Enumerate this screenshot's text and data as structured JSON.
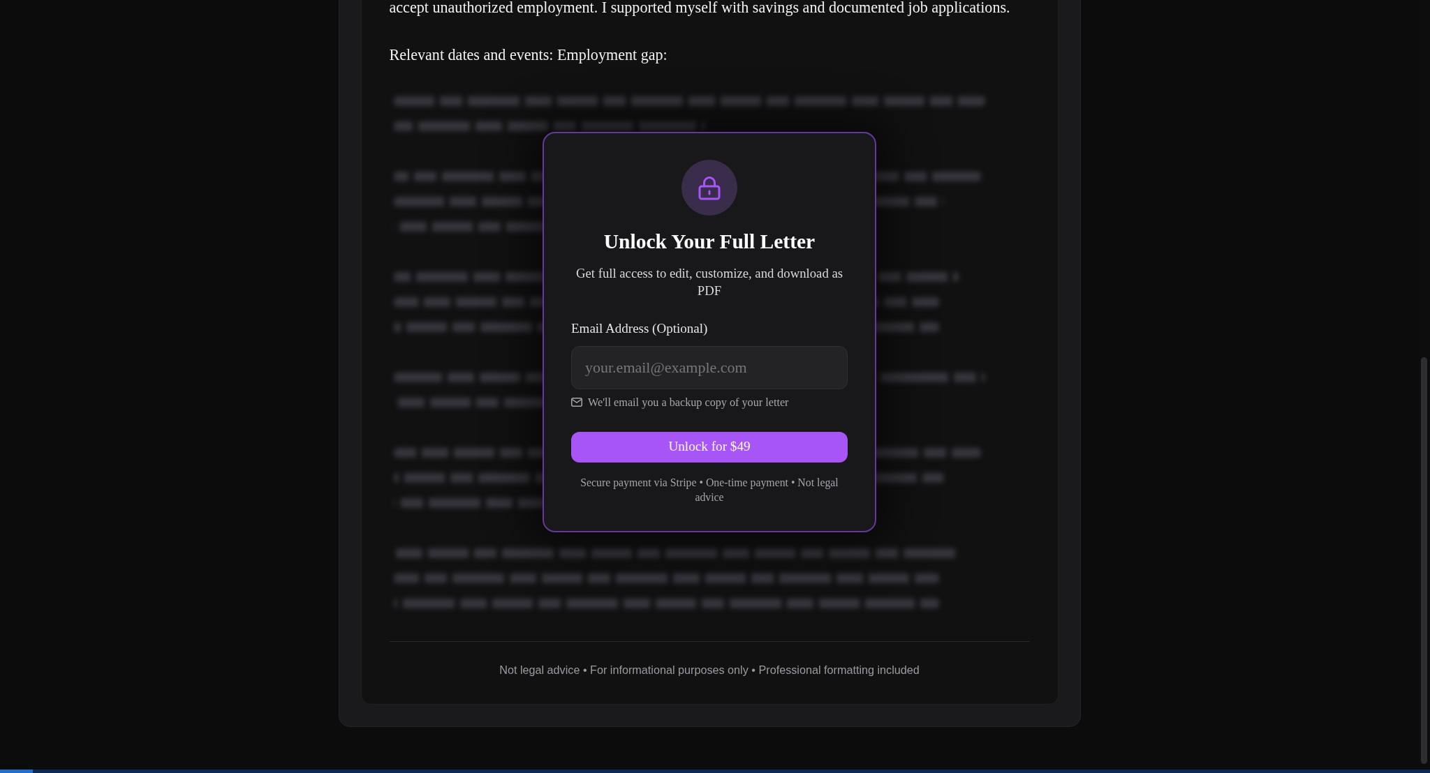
{
  "letter": {
    "paragraphs": [
      {
        "kind": "text",
        "text": "accept unauthorized employment. I supported myself with savings and documented job applications."
      },
      {
        "kind": "text",
        "text": "Relevant dates and events: Employment gap:"
      },
      {
        "kind": "blurred"
      },
      {
        "kind": "blurred"
      },
      {
        "kind": "blurred"
      },
      {
        "kind": "blurred"
      },
      {
        "kind": "blurred"
      },
      {
        "kind": "blurred"
      }
    ],
    "footer": "Not legal advice • For informational purposes only • Professional formatting included"
  },
  "unlock_dialog": {
    "title": "Unlock Your Full Letter",
    "subtitle": "Get full access to edit, customize, and download as PDF",
    "email_field": {
      "label": "Email Address (Optional)",
      "placeholder": "your.email@example.com"
    },
    "hint": "We'll email you a backup copy of your letter",
    "button": "Unlock for $49",
    "fine_print": "Secure payment via Stripe • One-time payment • Not legal advice"
  }
}
